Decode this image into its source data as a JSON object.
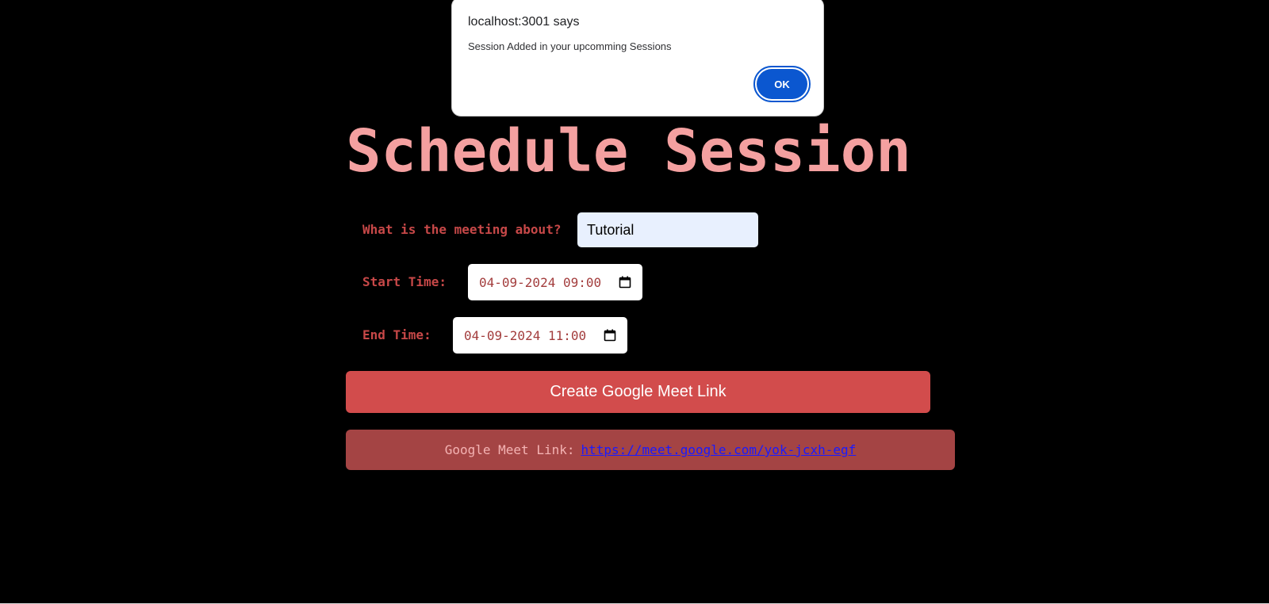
{
  "dialog": {
    "title": "localhost:3001 says",
    "message": "Session Added in your upcomming Sessions",
    "ok_label": "OK"
  },
  "page": {
    "title": "Schedule Session"
  },
  "form": {
    "topic_label": "What is the meeting about?",
    "topic_value": "Tutorial",
    "start_label": "Start Time:",
    "start_value": "04-09-2024 09:00",
    "end_label": "End Time:",
    "end_value": "04-09-2024 11:00",
    "calendar_icon": "calendar-icon"
  },
  "actions": {
    "create_label": "Create Google Meet Link"
  },
  "result": {
    "label": "Google Meet Link:",
    "link": "https://meet.google.com/yok-jcxh-egf"
  },
  "colors": {
    "background": "#000000",
    "title": "#f4a0a0",
    "label": "#c74848",
    "button": "#d24c4c",
    "result_box": "#a44444",
    "link": "#1a1aff",
    "dialog_button": "#0b57d0"
  }
}
